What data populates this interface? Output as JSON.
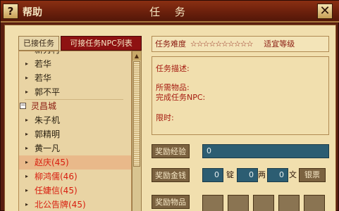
{
  "window": {
    "help_icon": "?",
    "help_label": "帮助",
    "title": "任 务",
    "close_icon": "✕"
  },
  "tabs": {
    "accepted": "已接任务",
    "available": "可接任务NPC列表"
  },
  "list": {
    "partial_top": "新秀村",
    "rows": [
      {
        "label": "若华",
        "type": "npc"
      },
      {
        "label": "若华",
        "type": "npc"
      },
      {
        "label": "郭不平",
        "type": "npc"
      },
      {
        "label": "灵昌城",
        "type": "group",
        "icon": "⊟"
      },
      {
        "label": "朱子机",
        "type": "npc"
      },
      {
        "label": "郭精明",
        "type": "npc"
      },
      {
        "label": "黄一凡",
        "type": "npc"
      },
      {
        "label": "赵庆(45)",
        "type": "npc",
        "selected": true
      },
      {
        "label": "柳鸿儒(46)",
        "type": "npc"
      },
      {
        "label": "任婕信(45)",
        "type": "npc"
      },
      {
        "label": "北公告牌(45)",
        "type": "npc"
      }
    ],
    "marker": "▸",
    "group_marker": "−"
  },
  "scroll": {
    "up_icon": "▲"
  },
  "detail": {
    "difficulty_label": "任务难度",
    "stars": "☆☆☆☆☆☆☆☆☆☆",
    "level_label": "适宜等级",
    "desc_label": "任务描述:",
    "items_label": "所需物品:",
    "npc_label": "完成任务NPC:",
    "time_label": "限时:"
  },
  "rewards": {
    "exp_label": "奖励经验",
    "exp_value": "0",
    "money_label": "奖励金钱",
    "ding": "0",
    "ding_unit": "锭",
    "liang": "0",
    "liang_unit": "两",
    "wen": "0",
    "wen_unit": "文",
    "silver_btn": "银票",
    "items_label": "奖励物品"
  },
  "colors": {
    "frame": "#5a1e10",
    "panel": "#f1dfae",
    "red_text": "#d81e0f",
    "tab_active": "#8e1212",
    "reward_box": "#2c5d72"
  }
}
